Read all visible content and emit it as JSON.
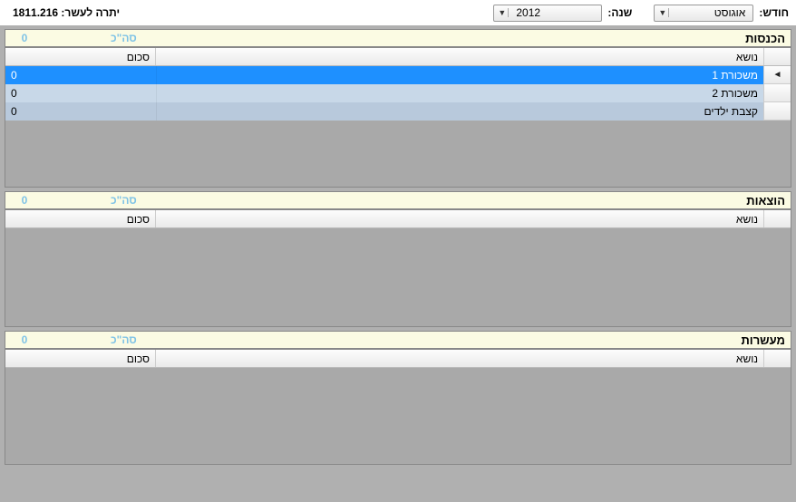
{
  "topbar": {
    "month_label": "חודש:",
    "month_value": "אוגוסט",
    "year_label": "שנה:",
    "year_value": "2012",
    "balance_label": "יתרה לעשר:",
    "balance_value": "1811.216"
  },
  "sections": {
    "income": {
      "title": "הכנסות",
      "total_label": "סה\"כ",
      "total_value": "0",
      "col_subject": "נושא",
      "col_amount": "סכום",
      "rows": [
        {
          "subject": "משכורת 1",
          "amount": "0",
          "selected": true
        },
        {
          "subject": "משכורת 2",
          "amount": "0"
        },
        {
          "subject": "קצבת ילדים",
          "amount": "0"
        }
      ]
    },
    "expenses": {
      "title": "הוצאות",
      "total_label": "סה\"כ",
      "total_value": "0",
      "col_subject": "נושא",
      "col_amount": "סכום",
      "rows": []
    },
    "tithe": {
      "title": "מעשרות",
      "total_label": "סה\"כ",
      "total_value": "0",
      "col_subject": "נושא",
      "col_amount": "סכום",
      "rows": []
    }
  }
}
